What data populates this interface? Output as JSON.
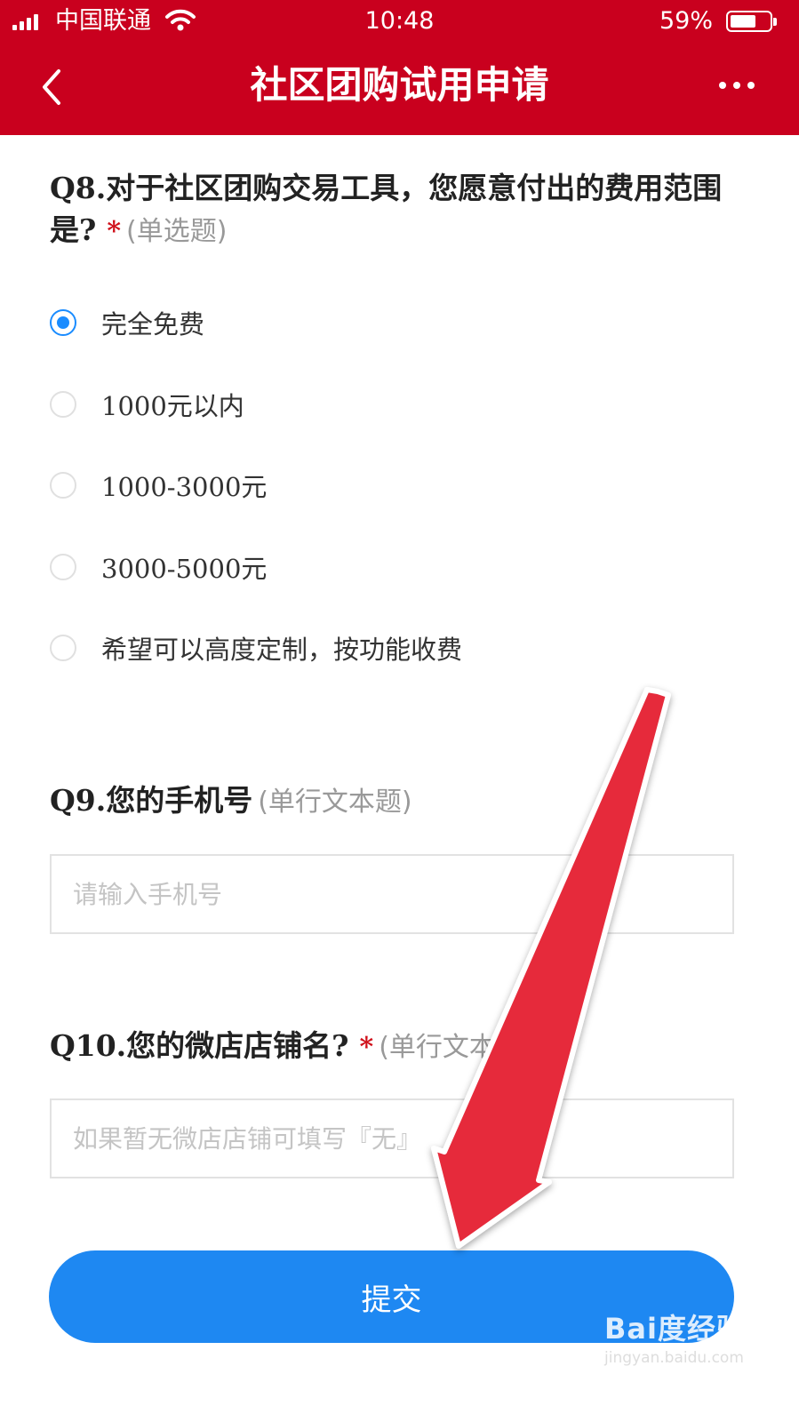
{
  "status_bar": {
    "carrier": "中国联通",
    "time": "10:48",
    "battery_percent": "59%"
  },
  "header": {
    "title": "社区团购试用申请",
    "background_color": "#c9001e"
  },
  "q8": {
    "title": "Q8.对于社区团购交易工具，您愿意付出的费用范围是?",
    "required_mark": "*",
    "type_hint": "(单选题)",
    "options": [
      {
        "label": "完全免费",
        "selected": true
      },
      {
        "label": "1000元以内",
        "selected": false
      },
      {
        "label": "1000-3000元",
        "selected": false
      },
      {
        "label": "3000-5000元",
        "selected": false
      },
      {
        "label": "希望可以高度定制，按功能收费",
        "selected": false
      }
    ]
  },
  "q9": {
    "title": "Q9.您的手机号",
    "type_hint": "(单行文本题)",
    "placeholder": "请输入手机号",
    "value": ""
  },
  "q10": {
    "title": "Q10.您的微店店铺名?",
    "required_mark": "*",
    "type_hint": "(单行文本题)",
    "placeholder": "如果暂无微店店铺可填写『无』",
    "value": ""
  },
  "submit_label": "提交",
  "accent_color": "#1e88f2",
  "watermark": {
    "logo": "Bai度经验",
    "url": "jingyan.baidu.com"
  }
}
